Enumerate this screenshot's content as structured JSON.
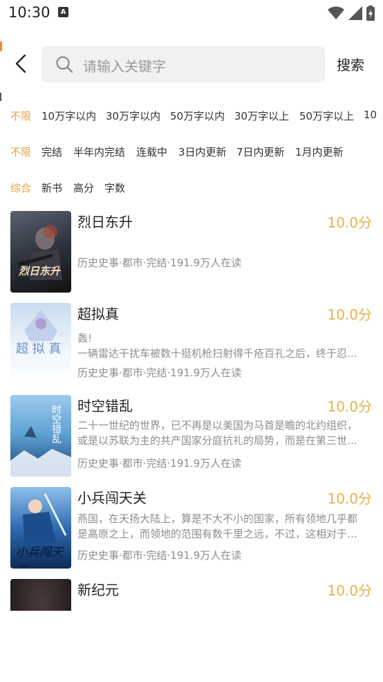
{
  "status": {
    "time": "10:30",
    "notif_glyph": "A"
  },
  "header": {
    "search_placeholder": "请输入关键字",
    "search_label": "搜索"
  },
  "filters": {
    "word_count": {
      "active": "不限",
      "options": [
        "10万字以内",
        "30万字以内",
        "50万字以内",
        "30万字以上",
        "50万字以上",
        "10"
      ]
    },
    "status": {
      "active": "不限",
      "options": [
        "完结",
        "半年内完结",
        "连载中",
        "3日内更新",
        "7日内更新",
        "1月内更新"
      ]
    },
    "sort": {
      "active": "综合",
      "options": [
        "新书",
        "高分",
        "字数"
      ]
    }
  },
  "books": [
    {
      "title": "烈日东升",
      "score": "10.0分",
      "desc1": "",
      "desc2": "",
      "meta": "历史史事·都市·完结·191.9万人在读",
      "cover_text": "烈日东升",
      "cover_color": "#2a2f3a"
    },
    {
      "title": "超拟真",
      "score": "10.0分",
      "desc1": "轰!",
      "desc2": "一辆雷达干扰车被数十挺机枪扫射得千疮百孔之后，终于忍…",
      "meta": "历史史事·都市·完结·191.9万人在读",
      "cover_text": "超 拟 真",
      "cover_color": "#dbe9f5"
    },
    {
      "title": "时空错乱",
      "score": "10.0分",
      "desc1": "二十一世纪的世界，已不再是以美国为马首是瞻的北约组织，",
      "desc2": "或是以苏联为主的共产国家分庭抗礼的局势，而是在第三世…",
      "meta": "历史史事·都市·完结·191.9万人在读",
      "cover_text": "时空错乱",
      "cover_color": "#5b9fd2"
    },
    {
      "title": "小兵闯天关",
      "score": "10.0分",
      "desc1": "燕国，在天扬大陆上，算是不大不小的国家，所有领地几乎都",
      "desc2": "是高原之上，而领地的范围有数千里之远，不过，这相对于…",
      "meta": "历史史事·都市·完结·191.9万人在读",
      "cover_text": "小兵闯天关",
      "cover_color": "#2f6bb0"
    },
    {
      "title": "新纪元",
      "score": "10.0分",
      "desc1": "",
      "desc2": "",
      "meta": "",
      "cover_text": "",
      "cover_color": "#2b2424"
    }
  ],
  "colors": {
    "accent": "#e8a33a",
    "score": "#e8b04a"
  }
}
